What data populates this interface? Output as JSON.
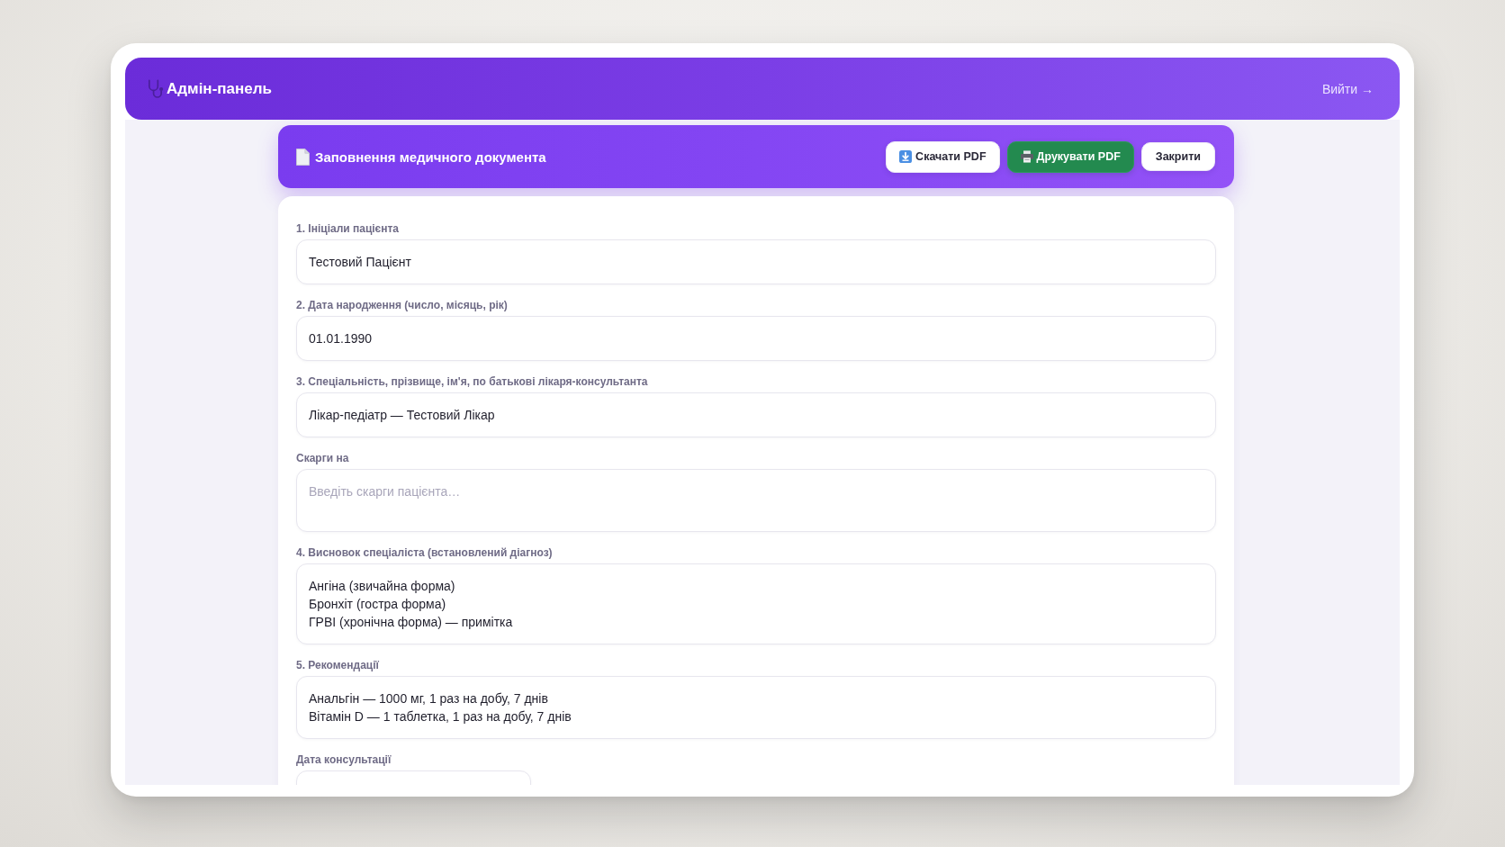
{
  "header": {
    "title": "Адмін-панель",
    "logout": "Вийти →"
  },
  "document_toolbar": {
    "title": "Заповнення медичного документа",
    "buttons": [
      {
        "label": "Скачати PDF",
        "kind": "download"
      },
      {
        "label": "Друкувати PDF",
        "kind": "print"
      },
      {
        "label": "Закрити",
        "kind": "close"
      }
    ]
  },
  "form": {
    "fields": [
      {
        "label": "1. Ініціали пацієнта",
        "kind": "input",
        "value": "Тестовий Пацієнт"
      },
      {
        "label": "2. Дата народження (число, місяць, рік)",
        "kind": "input",
        "value": "01.01.1990"
      },
      {
        "label": "3. Спеціальність, прізвище, ім'я, по батькові лікаря-консультанта",
        "kind": "input",
        "value": "Лікар-педіатр — Тестовий Лікар"
      },
      {
        "label": "Скарги на",
        "kind": "textarea",
        "placeholder": "Введіть скарги пацієнта…"
      },
      {
        "label": "4. Висновок спеціаліста (встановлений діагноз)",
        "kind": "textarea",
        "lines": [
          "Ангіна (звичайна форма)",
          "Бронхіт (гостра форма)",
          "ГРВІ (хронічна форма) — примітка"
        ]
      },
      {
        "label": "5. Рекомендації",
        "kind": "textarea",
        "lines": [
          "Анальгін — 1000 мг, 1 раз на добу, 7 днів",
          "Вітамін D — 1 таблетка, 1 раз на добу, 7 днів"
        ]
      },
      {
        "label": "Дата консультації",
        "kind": "date"
      }
    ]
  }
}
